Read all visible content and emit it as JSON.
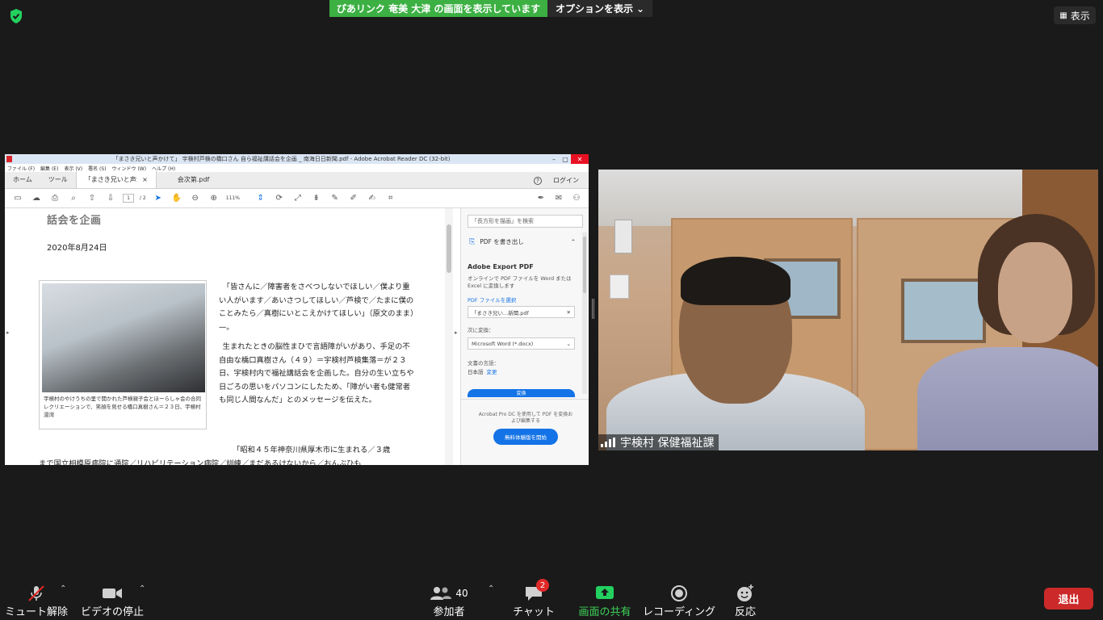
{
  "top": {
    "share_banner": "ぴあリンク 奄美 大津 の画面を表示しています",
    "options_label": "オプションを表示",
    "view_label": "表示"
  },
  "acrobat": {
    "title": "「まさき兄いと声かけて」 宇検村芦検の橋口さん 自ら福祉講話会を企画 _ 南海日日新聞.pdf - Adobe Acrobat Reader DC (32-bit)",
    "menu": [
      "ファイル (F)",
      "編集 (E)",
      "表示 (V)",
      "署名 (S)",
      "ウィンドウ (W)",
      "ヘルプ (H)"
    ],
    "tabs": [
      "ホーム",
      "ツール",
      "「まさき兄いと声か...",
      "会次第.pdf"
    ],
    "tab_close": "×",
    "login_label": "ログイン",
    "page_current": "1",
    "page_total": "/ 2",
    "zoom": "111%",
    "doc": {
      "heading": "話会を企画",
      "date": "2020年8月24日",
      "photo_caption": "宇検村のやけうちの里で開かれた芦検親子会とほーらしゃ会の合同レクリエーションで、笑顔を見せる橋口真樹さん＝２３日、宇検村湯湾",
      "para1": "「皆さんに／障害者をさべつしないでほしい／僕より重い人がいます／あいさつしてほしい／芦検で／たまに僕のことみたら／真樹にいとこえかけてほしい」（原文のまま）—。",
      "para2": "生まれたときの脳性まひで言語障がいがあり、手足の不自由な橋口真樹さん（４９）＝宇検村芦検集落＝が２３日、宇検村内で福祉講話会を企画した。自分の生い立ちや日ごろの思いをパソコンにしたため、「障がい者も健常者も同じ人間なんだ」とのメッセージを伝えた。",
      "para3": "「昭和４５年神奈川県厚木市に生まれる／３歳",
      "para4": "まで国立相模原病院に通院／リハビリテーション病院／訓練／まだあるけないから／おんぶひも"
    },
    "pane": {
      "search_placeholder": "「長方形を描画」を検索",
      "edit_pdf": "PDF を書き出し",
      "export_title": "Adobe Export PDF",
      "export_desc": "オンラインで PDF ファイルを Word または Excel に変換します",
      "select_file": "PDF ファイルを選択",
      "file_name": "「まさき兄い...新聞.pdf",
      "convert_label": "次に変換：",
      "convert_option": "Microsoft Word (*.docx)",
      "lang_label": "文書の言語：",
      "lang_value": "日本語",
      "lang_change": "変更",
      "convert_button": "変換",
      "promo": "Acrobat Pro DC を使用して PDF を変換および編集する",
      "trial_button": "無料体験版を開始"
    }
  },
  "video": {
    "participant_name": "宇検村 保健福祉課"
  },
  "toolbar": {
    "mute": "ミュート解除",
    "video": "ビデオの停止",
    "participants": "参加者",
    "participants_count": "40",
    "chat": "チャット",
    "chat_badge": "2",
    "share": "画面の共有",
    "record": "レコーディング",
    "reactions": "反応",
    "leave": "退出"
  },
  "colors": {
    "share_green": "#3cb043",
    "leave_red": "#cc2a2a",
    "acrobat_blue": "#1473e6"
  }
}
